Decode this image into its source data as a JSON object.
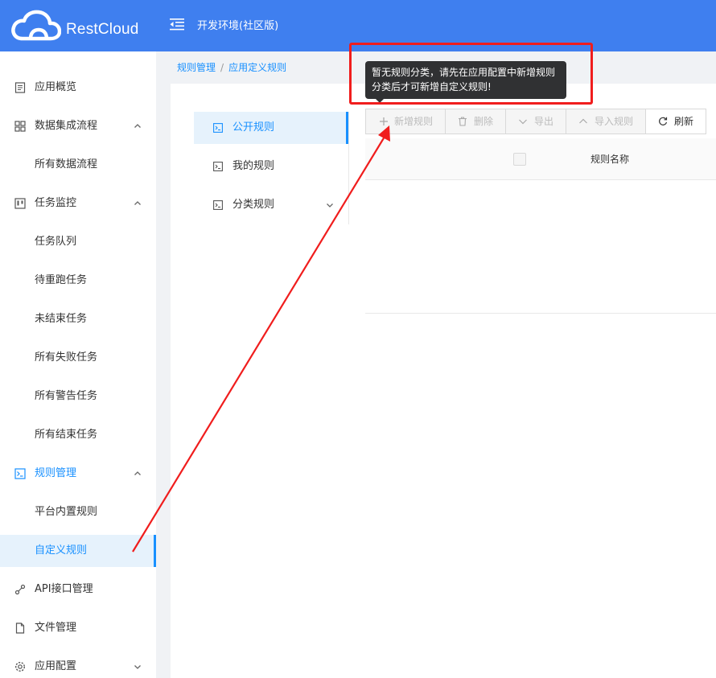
{
  "header": {
    "brand": "RestCloud",
    "environment": "开发环境(社区版)",
    "brand_color": "#3f7fef"
  },
  "sidebar": {
    "items": [
      {
        "label": "应用概览",
        "icon": "file-list-icon"
      },
      {
        "label": "数据集成流程",
        "icon": "grid-icon",
        "expanded": true
      },
      {
        "label": "所有数据流程"
      },
      {
        "label": "任务监控",
        "icon": "kanban-icon",
        "expanded": true
      },
      {
        "label": "任务队列"
      },
      {
        "label": "待重跑任务"
      },
      {
        "label": "未结束任务"
      },
      {
        "label": "所有失败任务"
      },
      {
        "label": "所有警告任务"
      },
      {
        "label": "所有结束任务"
      },
      {
        "label": "规则管理",
        "icon": "terminal-icon",
        "expanded": true
      },
      {
        "label": "平台内置规则"
      },
      {
        "label": "自定义规则",
        "selected": true
      },
      {
        "label": "API接口管理",
        "icon": "api-icon"
      },
      {
        "label": "文件管理",
        "icon": "file-icon"
      },
      {
        "label": "应用配置",
        "icon": "gear-icon",
        "expanded": false
      }
    ]
  },
  "breadcrumb": {
    "items": [
      "规则管理",
      "应用定义规则"
    ],
    "separator": "/"
  },
  "categories": {
    "items": [
      {
        "label": "公开规则",
        "selected": true
      },
      {
        "label": "我的规则"
      },
      {
        "label": "分类规则"
      }
    ]
  },
  "toolbar": {
    "add": "新增规则",
    "delete": "删除",
    "export": "导出",
    "import": "导入规则",
    "refresh": "刷新"
  },
  "table": {
    "columns": [
      "规则名称"
    ]
  },
  "tooltip": {
    "line1": "暂无规则分类，请先在应用配置中新增规则",
    "line2": "分类后才可新增自定义规则!"
  },
  "colors": {
    "accent": "#1890ff",
    "annotation": "#f01d1d",
    "tooltip_bg": "#303133"
  }
}
